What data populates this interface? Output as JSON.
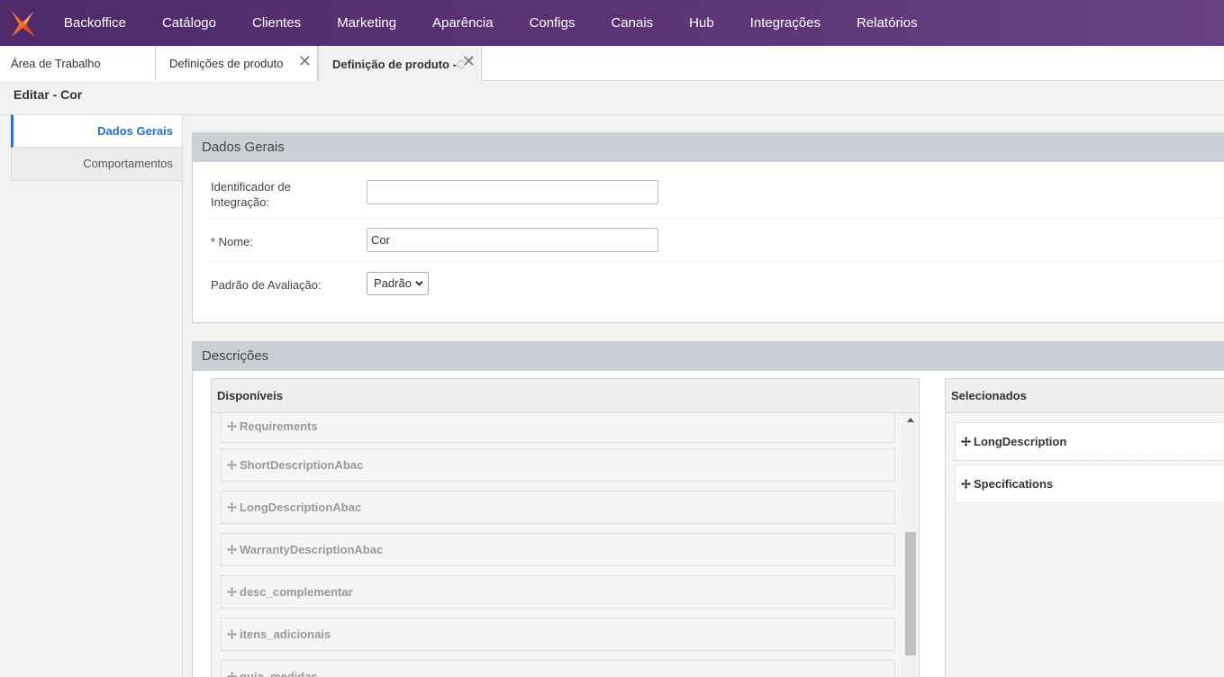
{
  "nav": {
    "logo_icon": "brand-logo-icon",
    "items": [
      "Backoffice",
      "Catálogo",
      "Clientes",
      "Marketing",
      "Aparência",
      "Configs",
      "Canais",
      "Hub",
      "Integrações",
      "Relatórios"
    ]
  },
  "tabs": [
    {
      "label": "Área de Trabalho"
    },
    {
      "label": "Definições de produto",
      "close": "✕"
    },
    {
      "label": "Definição de produto - ",
      "label_fade": "C",
      "close": "✕"
    }
  ],
  "page_title": "Editar - Cor",
  "side_menu": [
    "Dados Gerais",
    "Comportamentos"
  ],
  "general": {
    "title": "Dados Gerais",
    "integration_label": "Identificador de Integração:",
    "integration_value": "",
    "name_label": "* Nome:",
    "name_value": "Cor",
    "rating_label": "Padrão de Avaliação:",
    "rating_value": "Padrão"
  },
  "descriptions": {
    "title": "Descrições",
    "available_title": "Disponíveis",
    "selected_title": "Selecionados",
    "available": [
      "Requirements",
      "ShortDescriptionAbac",
      "LongDescriptionAbac",
      "WarrantyDescriptionAbac",
      "desc_complementar",
      "itens_adicionais",
      "guia_medidas"
    ],
    "selected": [
      "LongDescription",
      "Specifications"
    ]
  },
  "colors": {
    "accent": "#1e6fd8",
    "header_purple": "#5d3577",
    "panel_head": "#cbd0d6"
  }
}
